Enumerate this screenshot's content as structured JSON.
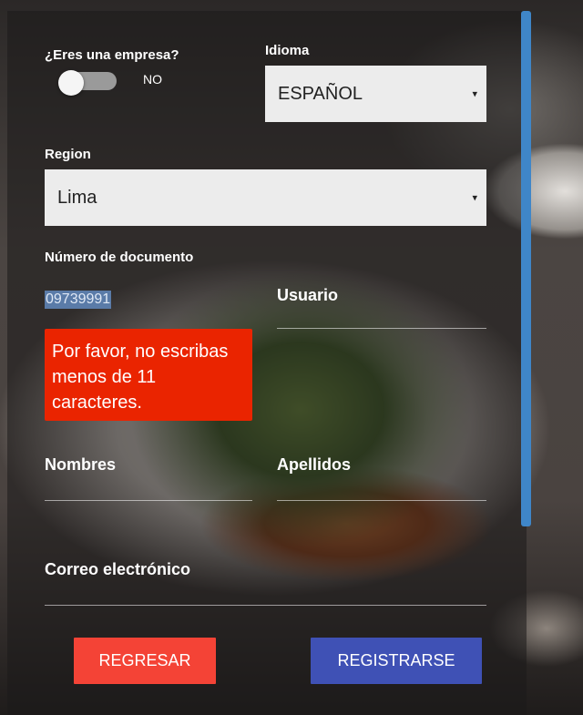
{
  "company": {
    "label": "¿Eres una empresa?",
    "toggle_text": "NO",
    "is_company": false
  },
  "language": {
    "label": "Idioma",
    "selected": "ESPAÑOL"
  },
  "region": {
    "label": "Region",
    "selected": "Lima"
  },
  "document": {
    "label": "Número de documento",
    "value": "09739991",
    "error": "Por favor, no escribas menos de 11 caracteres."
  },
  "fields": {
    "usuario": "Usuario",
    "nombres": "Nombres",
    "apellidos": "Apellidos",
    "correo": "Correo electrónico"
  },
  "buttons": {
    "back": "REGRESAR",
    "register": "REGISTRARSE"
  },
  "colors": {
    "back_button": "#f44336",
    "register_button": "#3f51b5",
    "error": "#ea2400",
    "scrollbar": "#3f86c8"
  },
  "icons": {
    "select_caret": "▾"
  }
}
